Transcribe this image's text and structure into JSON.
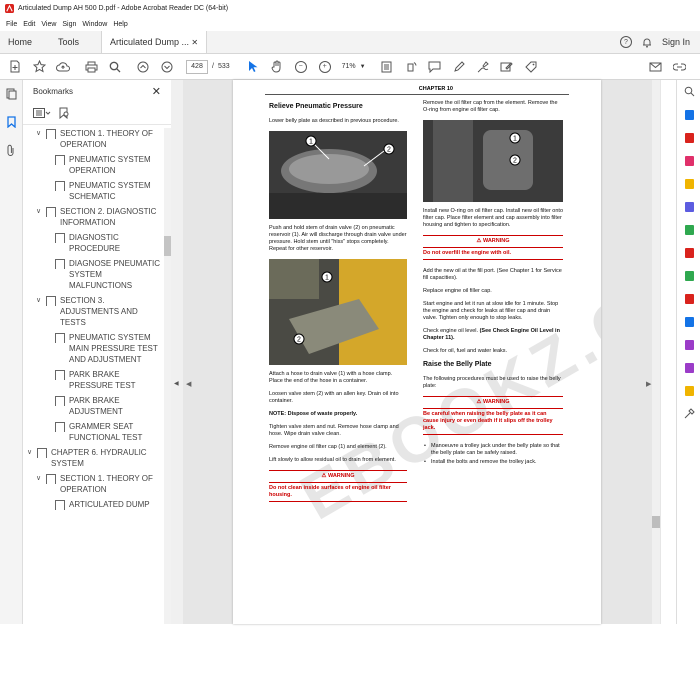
{
  "window": {
    "title": "Articulated Dump AH 500 D.pdf - Adobe Acrobat Reader DC (64-bit)"
  },
  "menu": [
    "File",
    "Edit",
    "View",
    "Sign",
    "Window",
    "Help"
  ],
  "tabs": {
    "home": "Home",
    "tools": "Tools",
    "doc": "Articulated Dump ...",
    "signin": "Sign In"
  },
  "toolbar": {
    "page_current": "428",
    "page_sep": "/",
    "page_total": "533",
    "zoom": "71%"
  },
  "bookmarks": {
    "title": "Bookmarks",
    "items": [
      {
        "label": "SECTION 1. THEORY OF OPERATION",
        "level": 1,
        "chev": "∨"
      },
      {
        "label": "PNEUMATIC SYSTEM OPERATION",
        "level": 2,
        "chev": ""
      },
      {
        "label": "PNEUMATIC SYSTEM SCHEMATIC",
        "level": 2,
        "chev": ""
      },
      {
        "label": "SECTION 2. DIAGNOSTIC INFORMATION",
        "level": 1,
        "chev": "∨"
      },
      {
        "label": "DIAGNOSTIC PROCEDURE",
        "level": 2,
        "chev": ""
      },
      {
        "label": "DIAGNOSE PNEUMATIC SYSTEM MALFUNCTIONS",
        "level": 2,
        "chev": ""
      },
      {
        "label": "SECTION 3. ADJUSTMENTS AND TESTS",
        "level": 1,
        "chev": "∨"
      },
      {
        "label": "PNEUMATIC SYSTEM MAIN PRESSURE TEST AND ADJUSTMENT",
        "level": 2,
        "chev": ""
      },
      {
        "label": "PARK BRAKE PRESSURE TEST",
        "level": 2,
        "chev": ""
      },
      {
        "label": "PARK BRAKE ADJUSTMENT",
        "level": 2,
        "chev": ""
      },
      {
        "label": "GRAMMER SEAT FUNCTIONAL TEST",
        "level": 2,
        "chev": ""
      },
      {
        "label": "CHAPTER 6. HYDRAULIC SYSTEM",
        "level": 0,
        "chev": "∨"
      },
      {
        "label": "SECTION 1. THEORY OF OPERATION",
        "level": 1,
        "chev": "∨"
      },
      {
        "label": "ARTICULATED DUMP",
        "level": 2,
        "chev": ""
      }
    ]
  },
  "doc": {
    "chapter": "CHAPTER 10",
    "left_heading": "Relieve Pneumatic Pressure",
    "left_p1": "Lower belly plate as described in previous procedure.",
    "left_p2": "Push and hold stem of drain valve (2) on pneumatic reservoir (1). Air will discharge through drain valve under pressure. Hold stem until \"hiss\" stops completely. Repeat for other reservoir.",
    "left_p3": "Attach a hose to drain valve (1) with a hose clamp. Place the end of the hose in a container.",
    "left_p4": "Loosen valve stem (2) with an allen key. Drain oil into container.",
    "left_note": "NOTE:  Dispose of waste properly.",
    "left_p5": "Tighten valve stem and nut. Remove hose clamp and hose. Wipe drain valve clean.",
    "left_p6": "Remove engine oil filter cap (1) and element (2).",
    "left_p7": "Lift slowly to allow residual oil to drain from element.",
    "left_warn_title": "WARNING",
    "left_warn_body": "Do not clean inside surfaces of engine oil filter housing.",
    "right_p1": "Remove the oil filter cap from the element. Remove the O-ring from engine oil filter cap.",
    "right_p2": "Install new O-ring on oil filter cap. Install new oil filter onto filter cap. Place filter element and cap assembly into filter housing and tighten to specification.",
    "right_warn1_title": "WARNING",
    "right_warn1_body": "Do not overfill the engine with oil.",
    "right_p3": "Add the new oil at the fill port. (See Chapter 1 for Service fill capacities).",
    "right_p4": "Replace engine oil filler cap.",
    "right_p5": "Start engine and let it run at slow idle for 1 minute. Stop the engine and check for leaks at filler cap and drain valve. Tighten only enough to stop leaks.",
    "right_p6a": "Check engine oil level. ",
    "right_p6b": "(See Check Engine Oil Level in Chapter 11).",
    "right_p7": "Check for oil, fuel and water leaks.",
    "right_heading": "Raise the Belly Plate",
    "right_p8": "The following procedures must be used to raise the belly plate:",
    "right_warn2_title": "WARNING",
    "right_warn2_body": "Be careful when raising the belly plate as it can cause injury or even death if it slips off the trolley jack.",
    "bullet1": "Manoeuvre a trolley jack under the belly plate so that the belly plate can be safely raised.",
    "bullet2": "Install the bolts and remove the trolley jack."
  },
  "colors": {
    "warning": "#cc0000",
    "accent": "#1473e6"
  }
}
